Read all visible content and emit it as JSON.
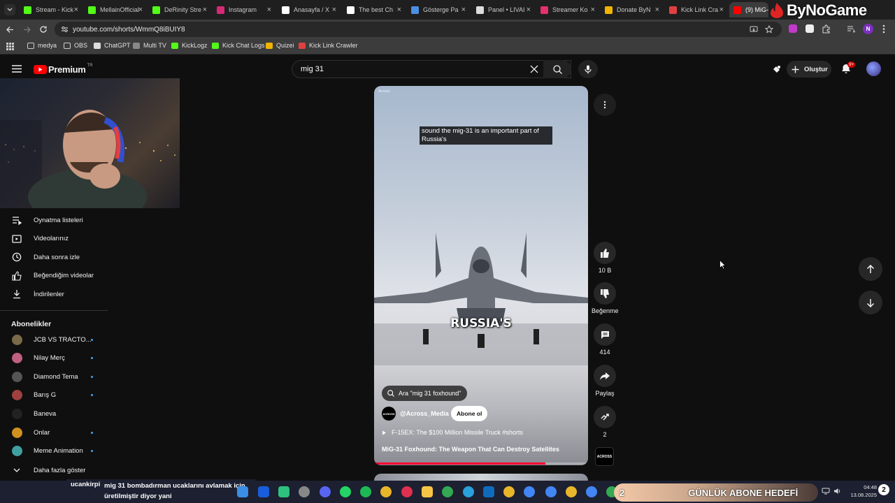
{
  "browser": {
    "tabs": [
      {
        "label": "Stream - Kick",
        "color": "#53fc18"
      },
      {
        "label": "MellainOfficial",
        "color": "#53fc18"
      },
      {
        "label": "DeRinity Stre",
        "color": "#53fc18"
      },
      {
        "label": "Instagram",
        "color": "#d62976"
      },
      {
        "label": "Anasayfa / X",
        "color": "#ffffff"
      },
      {
        "label": "The best Ch",
        "color": "#ffffff"
      },
      {
        "label": "Gösterge Pa",
        "color": "#4a90e2"
      },
      {
        "label": "Panel • LIVAI",
        "color": "#dddddd"
      },
      {
        "label": "Streamer Ko",
        "color": "#e5306f"
      },
      {
        "label": "Donate ByN",
        "color": "#f0b400"
      },
      {
        "label": "Kick Link Cra",
        "color": "#e04040"
      },
      {
        "label": "(9) MiG-",
        "color": "#ff0000"
      }
    ],
    "url": "youtube.com/shorts/WmmQ8iBUIY8",
    "bookmarks": [
      "medya",
      "OBS",
      "ChatGPT",
      "Multi TV",
      "KickLogz",
      "Kick Chat Logs",
      "Quizei",
      "Kick Link Crawler"
    ],
    "profile_letter": "N"
  },
  "overlay": {
    "brand": "ByNoGame",
    "chat_user": "ucankirpi",
    "chat_message": "mig 31 bombadırman ucaklarını avlamak için üretilmiştir diyor yani",
    "goal_count": "2",
    "goal_label": "GÜNLÜK ABONE HEDEFİ"
  },
  "youtube": {
    "logo": "Premium",
    "logo_sup": "TR",
    "search_value": "mig 31",
    "create_label": "Oluştur",
    "notif_count": "9+",
    "sidebar": [
      {
        "label": "Oynatma listeleri",
        "icon": "playlist-icon"
      },
      {
        "label": "Videolarınız",
        "icon": "video-icon"
      },
      {
        "label": "Daha sonra izle",
        "icon": "clock-icon"
      },
      {
        "label": "Beğendiğim videolar",
        "icon": "like-icon"
      },
      {
        "label": "İndirilenler",
        "icon": "download-icon"
      }
    ],
    "subs_title": "Abonelikler",
    "subs": [
      {
        "name": "JCB VS TRACTO...",
        "color": "#7a6a4a"
      },
      {
        "name": "Nilay Merç",
        "color": "#c06080"
      },
      {
        "name": "Diamond Tema",
        "color": "#555555"
      },
      {
        "name": "Barış G",
        "color": "#a04040"
      },
      {
        "name": "Baneva",
        "color": "#222222"
      },
      {
        "name": "Onlar",
        "color": "#d09020"
      },
      {
        "name": "Meme Animation",
        "color": "#40a0a0"
      }
    ],
    "show_more": "Daha fazla göster",
    "video": {
      "watermark": "Across",
      "caption": "sound the mig-31 is an important part of Russia's",
      "big_caption": "RUSSIA'S",
      "related_search": "Ara \"mig 31 foxhound\"",
      "channel": "@Across_Media",
      "channel_logo": "ACROSS",
      "subscribe": "Abone ol",
      "next_title": "F-15EX: The $100 Million Missile Truck #shorts",
      "title": "MiG-31 Foxhound: The Weapon That Can Destroy Satellites",
      "progress": 0.8
    },
    "actions": {
      "likes": "10 B",
      "dislike": "Beğenme",
      "comments": "414",
      "share": "Paylaş",
      "remix": "2",
      "channel_logo": "ACROSS"
    }
  },
  "clock": {
    "time": "04:48",
    "date": "13.08.2025"
  }
}
